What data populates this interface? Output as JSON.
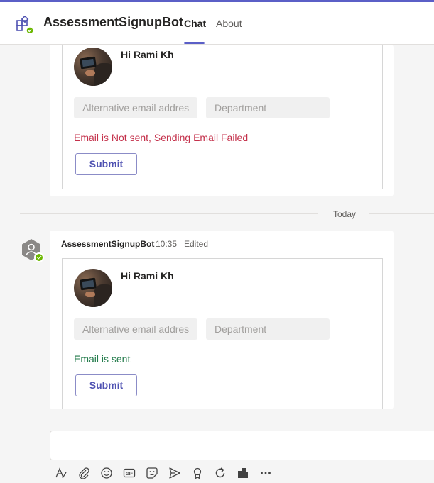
{
  "header": {
    "app_name": "AssessmentSignupBot",
    "tabs": [
      {
        "label": "Chat",
        "active": true
      },
      {
        "label": "About",
        "active": false
      }
    ],
    "accent_color": "#5b5fc7"
  },
  "messages": [
    {
      "greeting": "Hi Rami Kh",
      "inputs": [
        {
          "placeholder": "Alternative email addres"
        },
        {
          "placeholder": "Department"
        }
      ],
      "status_text": "Email is Not sent, Sending Email Failed",
      "status_color": "#c4314b",
      "submit_label": "Submit"
    },
    {
      "sender": "AssessmentSignupBot",
      "time": "10:35",
      "edited_label": "Edited",
      "greeting": "Hi Rami Kh",
      "inputs": [
        {
          "placeholder": "Alternative email addres"
        },
        {
          "placeholder": "Department"
        }
      ],
      "status_text": "Email is sent",
      "status_color": "#237b4b",
      "submit_label": "Submit"
    }
  ],
  "divider": {
    "label": "Today"
  },
  "compose": {
    "toolbar_icons": [
      "format-icon",
      "attach-icon",
      "emoji-icon",
      "gif-icon",
      "sticker-icon",
      "schedule-send-icon",
      "praise-icon",
      "loop-icon",
      "apps-icon",
      "more-options-icon"
    ]
  }
}
